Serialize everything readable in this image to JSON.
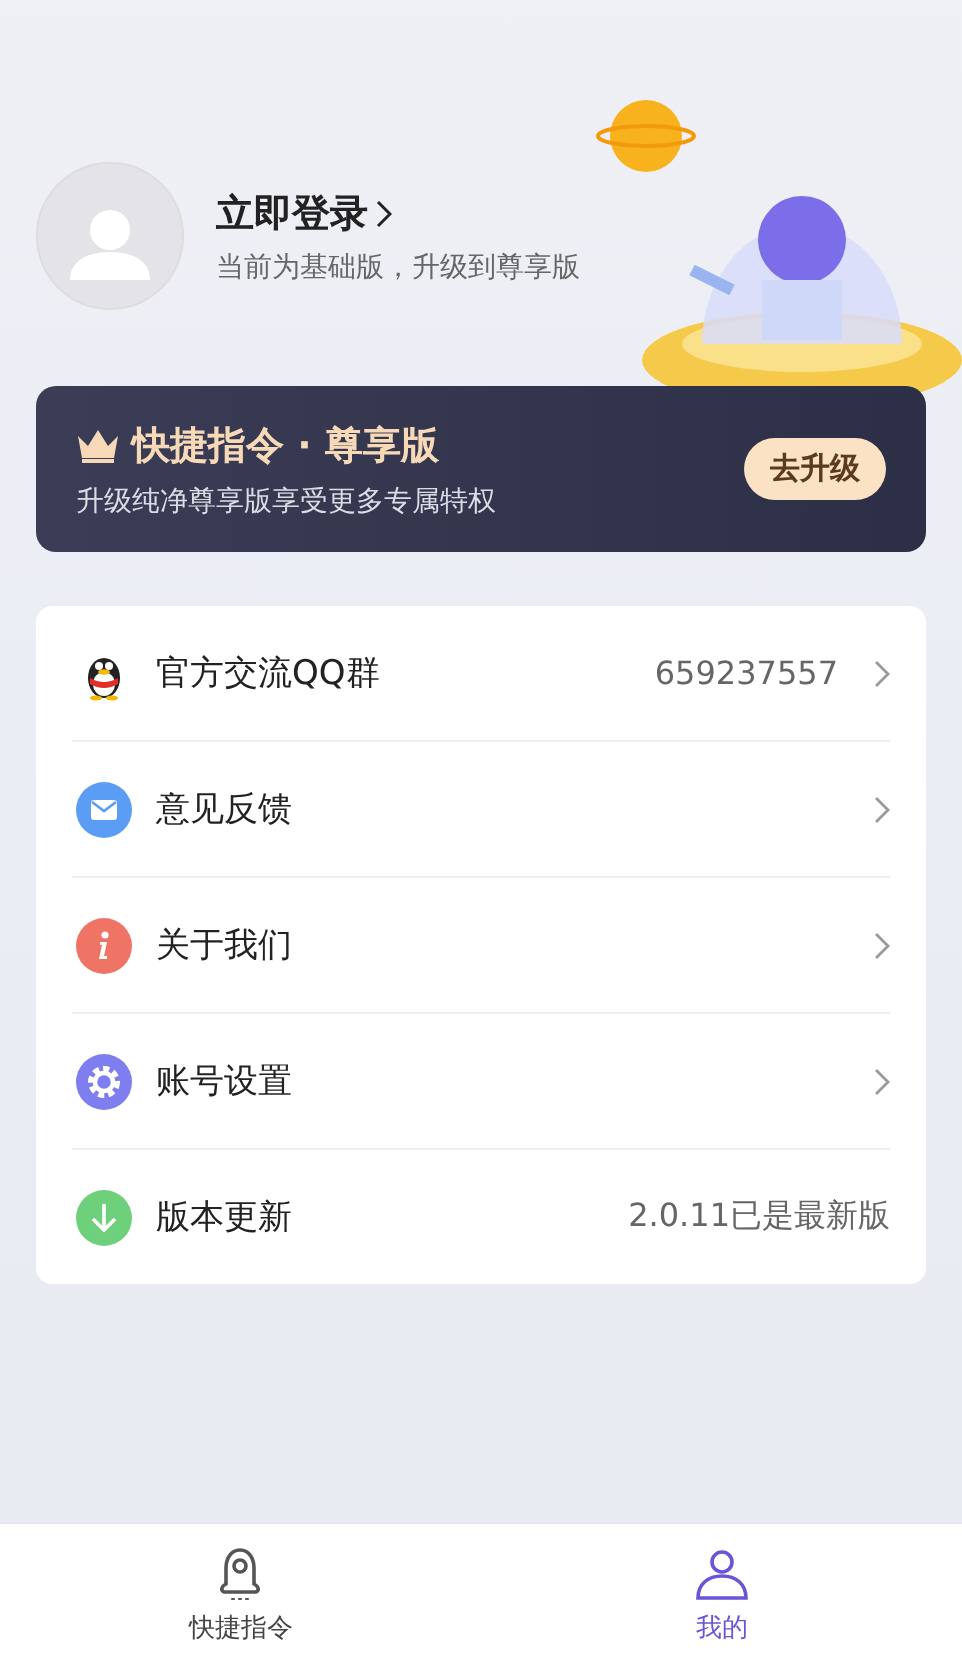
{
  "profile": {
    "title": "立即登录",
    "subtitle": "当前为基础版，升级到尊享版"
  },
  "banner": {
    "title": "快捷指令 · 尊享版",
    "subtitle": "升级纯净尊享版享受更多专属特权",
    "button": "去升级"
  },
  "menu": [
    {
      "kind": "qq",
      "label": "官方交流QQ群",
      "value": "659237557",
      "arrow": true
    },
    {
      "kind": "mail",
      "label": "意见反馈",
      "arrow": true
    },
    {
      "kind": "info",
      "label": "关于我们",
      "arrow": true
    },
    {
      "kind": "gear",
      "label": "账号设置",
      "arrow": true
    },
    {
      "kind": "download",
      "label": "版本更新",
      "value": "2.0.11已是最新版",
      "arrow": false
    }
  ],
  "tabs": [
    {
      "kind": "rocket",
      "label": "快捷指令",
      "selected": false
    },
    {
      "kind": "person",
      "label": "我的",
      "selected": true
    }
  ]
}
